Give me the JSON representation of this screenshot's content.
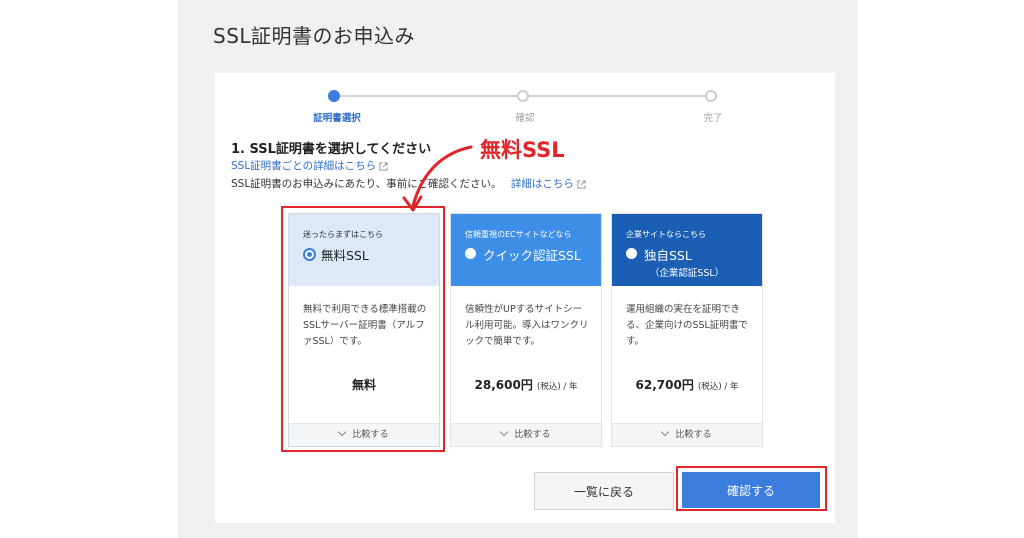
{
  "page": {
    "title": "SSL証明書のお申込み"
  },
  "stepper": {
    "steps": [
      {
        "label": "証明書選択",
        "active": true
      },
      {
        "label": "確認",
        "active": false
      },
      {
        "label": "完了",
        "active": false
      }
    ]
  },
  "section": {
    "heading": "1. SSL証明書を選択してください",
    "detail_link": "SSL証明書ごとの詳細はこちら",
    "notice_prefix": "SSL証明書のお申込みにあたり、事前にご確認ください。",
    "notice_link": "詳細はこちら"
  },
  "annotation": {
    "label": "無料SSL"
  },
  "plans": [
    {
      "tag": "迷ったらまずはこちら",
      "name": "無料SSL",
      "sub": "",
      "selected": true,
      "description": "無料で利用できる標準搭載のSSLサーバー証明書（アルファSSL）です。",
      "price": "無料",
      "tax_note": "",
      "per": "",
      "compare_label": "比較する",
      "header_color": "#dde9f8"
    },
    {
      "tag": "信頼重視のECサイトなどなら",
      "name": "クイック認証SSL",
      "sub": "",
      "selected": false,
      "description": "信頼性がUPするサイトシール利用可能。導入はワンクリックで簡単です。",
      "price": "28,600円",
      "tax_note": "(税込)",
      "per": " / 年",
      "compare_label": "比較する",
      "header_color": "#3d8ee6"
    },
    {
      "tag": "企業サイトならこちら",
      "name": "独自SSL",
      "sub": "（企業認証SSL）",
      "selected": false,
      "description": "運用組織の実在を証明できる、企業向けのSSL証明書です。",
      "price": "62,700円",
      "tax_note": "(税込)",
      "per": " / 年",
      "compare_label": "比較する",
      "header_color": "#1a5fb4"
    }
  ],
  "buttons": {
    "back_label": "一覧に戻る",
    "confirm_label": "確認する"
  },
  "colors": {
    "accent": "#3b7ddd",
    "annotation_red": "#e0252b"
  }
}
